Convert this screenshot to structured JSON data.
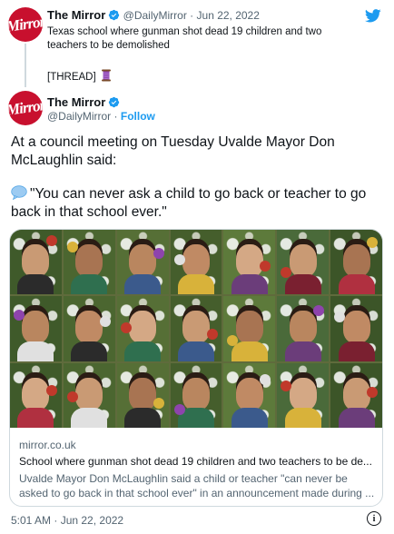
{
  "quoted": {
    "avatar_text": "Mirror",
    "name": "The Mirror",
    "handle": "@DailyMirror",
    "separator": "·",
    "date": "Jun 22, 2022",
    "text": "Texas school where gunman shot dead 19 children and two teachers to be demolished",
    "thread_label": "[THREAD]"
  },
  "main": {
    "avatar_text": "Mirror",
    "name": "The Mirror",
    "handle": "@DailyMirror",
    "separator": "·",
    "follow_label": "Follow",
    "body_line1": "At a council meeting on Tuesday Uvalde Mayor Don McLaughlin said:",
    "body_quote": "\"You can never ask a child to go back or teacher to go back in that school ever.\""
  },
  "card": {
    "domain": "mirror.co.uk",
    "title": "School where gunman shot dead 19 children and two teachers to be de...",
    "description": "Uvalde Mayor Don McLaughlin said a child or teacher \"can never be asked to go back in that school ever\" in an announcement made during ..."
  },
  "footer": {
    "timestamp": "5:01 AM · Jun 22, 2022"
  },
  "icons": {
    "bird": "twitter-bird-icon",
    "verified": "verified-badge-icon",
    "thread": "thread-spool-icon",
    "speech": "speech-balloon-icon",
    "info": "info-icon"
  },
  "colors": {
    "accent": "#1d9bf0",
    "brand_red": "#c8102e",
    "muted": "#536471"
  }
}
